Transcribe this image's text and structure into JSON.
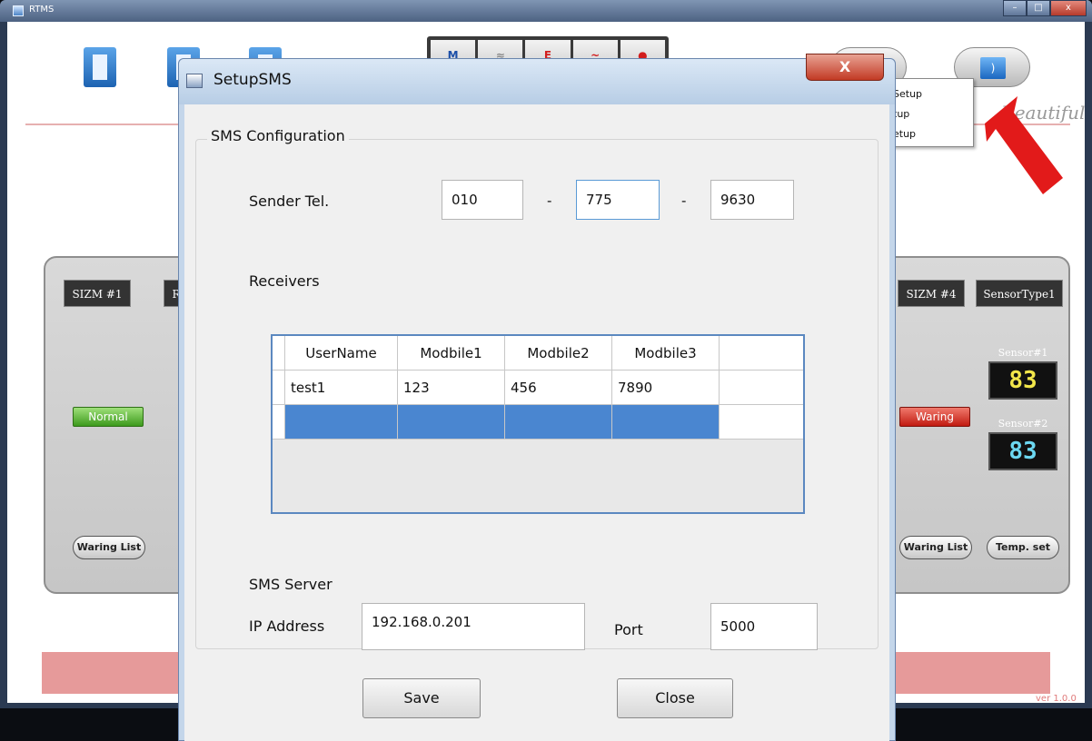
{
  "main_window": {
    "title": "RTMS",
    "window_buttons": {
      "minimize": "–",
      "maximize": "□",
      "close": "x"
    },
    "tool_strip": [
      "M",
      "≈",
      "E",
      "~",
      "●"
    ],
    "brand_text": "Beautiful",
    "dropdown_items": [
      "Setup",
      "tup",
      "etup"
    ],
    "zones": [
      {
        "label": "SIZM #1",
        "status": "Normal",
        "list_button": "Waring List"
      },
      {
        "label": "R"
      },
      {
        "label": "SIZM #4",
        "status": "Waring",
        "list_button": "Waring List"
      },
      {
        "label": "SensorType1",
        "temp_button": "Temp. set"
      }
    ],
    "sensors": [
      {
        "caption": "Sensor#1",
        "value": "83",
        "color": "#f2e64a"
      },
      {
        "caption": "Sensor#2",
        "value": "83",
        "color": "#6cd8f2"
      }
    ],
    "version": "ver 1.0.0"
  },
  "dialog": {
    "title": "SetupSMS",
    "close_icon": "X",
    "group_title": "SMS Configuration",
    "sender": {
      "label": "Sender Tel.",
      "part1": "010",
      "part2": "775",
      "part3": "9630",
      "separator": "-"
    },
    "receivers": {
      "label": "Receivers",
      "columns": [
        "UserName",
        "Modbile1",
        "Modbile2",
        "Modbile3"
      ],
      "rows": [
        [
          "test1",
          "123",
          "456",
          "7890"
        ]
      ]
    },
    "server": {
      "label": "SMS Server",
      "ip_label": "IP Address",
      "ip_value": "192.168.0.201",
      "port_label": "Port",
      "port_value": "5000"
    },
    "save_label": "Save",
    "close_label": "Close"
  }
}
